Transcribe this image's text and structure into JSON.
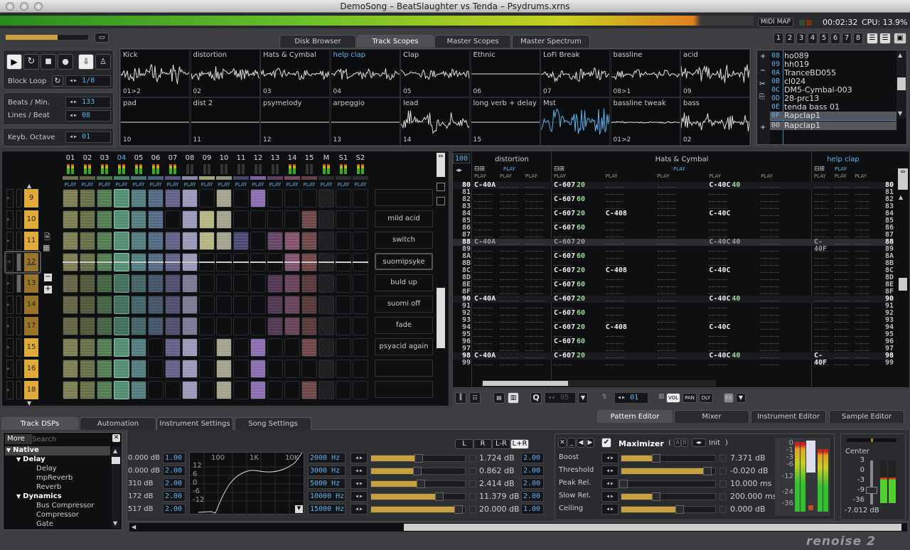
{
  "window": {
    "title": "DemoSong – BeatSlaughter vs Tenda – Psydrums.xrns"
  },
  "status": {
    "midi_map": "MIDI MAP",
    "time": "00:02:32",
    "cpu": "CPU: 13.9%"
  },
  "top_tabs": [
    "Disk Browser",
    "Track Scopes",
    "Master Scopes",
    "Master Spectrum"
  ],
  "top_tabs_active": 1,
  "layout_buttons": [
    "1",
    "2",
    "3",
    "4",
    "5",
    "6",
    "7",
    "8"
  ],
  "transport": {
    "block_loop_label": "Block Loop",
    "block_loop_value": "1/8",
    "bpm_label": "Beats / Min.",
    "bpm": "133",
    "lpb_label": "Lines / Beat",
    "lpb": "08",
    "octave_label": "Keyb. Octave",
    "octave": "01",
    "master_volume": 0.63
  },
  "scopes": [
    {
      "name": "Kick",
      "num": "01>2"
    },
    {
      "name": "distortion",
      "num": "02"
    },
    {
      "name": "Hats & Cymbal",
      "num": "03"
    },
    {
      "name": "help clap",
      "num": "04",
      "active": true
    },
    {
      "name": "Clap",
      "num": "05"
    },
    {
      "name": "Ethnic",
      "num": "06"
    },
    {
      "name": "LoFi Break",
      "num": "07"
    },
    {
      "name": "bassline",
      "num": "08>1"
    },
    {
      "name": "acid",
      "num": "09"
    },
    {
      "name": "pad",
      "num": "10"
    },
    {
      "name": "dist 2",
      "num": "11"
    },
    {
      "name": "psymelody",
      "num": "12"
    },
    {
      "name": "arpeggio",
      "num": "13"
    },
    {
      "name": "lead",
      "num": "14"
    },
    {
      "name": "long verb + delay",
      "num": "15"
    },
    {
      "name": "Mst",
      "num": "",
      "master": true
    },
    {
      "name": "bassline tweak",
      "num": "01>2"
    },
    {
      "name": "bass",
      "num": "02"
    }
  ],
  "instruments": [
    {
      "id": "08",
      "name": "ho089"
    },
    {
      "id": "09",
      "name": "hh019"
    },
    {
      "id": "0A",
      "name": "TranceBD055"
    },
    {
      "id": "0B",
      "name": "cl024"
    },
    {
      "id": "0C",
      "name": "DM5-Cymbal-003"
    },
    {
      "id": "0D",
      "name": "28-prc13"
    },
    {
      "id": "0E",
      "name": "tenda bass 01"
    },
    {
      "id": "0F",
      "name": "Rapclap1",
      "selected": true
    }
  ],
  "samples": [
    {
      "id": "00",
      "name": "Rapclap1",
      "selected": true
    }
  ],
  "matrix": {
    "tracks": [
      "01",
      "02",
      "03",
      "04",
      "05",
      "06",
      "07",
      "08",
      "09",
      "10",
      "11",
      "12",
      "13",
      "14",
      "15",
      "M",
      "S1",
      "S2"
    ],
    "play_label": "PLAY",
    "track_colors": [
      "#8a8a5c",
      "#6e7a4c",
      "#5a8a5a",
      "#5a9a7c",
      "#5a8a8c",
      "#5a7490",
      "#6a6a96",
      "#a8a8cc",
      "#c8c890",
      "#b4b49c",
      "#505080",
      "#9a78c4",
      "#704a70",
      "#905a78",
      "#7a4c4c",
      "#333333",
      "#333333",
      "#333333"
    ],
    "active_track": "04",
    "sequence": [
      {
        "pattern": "9",
        "name": "",
        "cells": "111111110101000h00"
      },
      {
        "pattern": "10",
        "name": "mild acid",
        "cells": "111111011100001h00"
      },
      {
        "pattern": "11",
        "name": "switch",
        "cells": "111111111110111h00"
      },
      {
        "pattern": "12",
        "name": "suomipsyke",
        "cells": "111111110000011h00",
        "current": true
      },
      {
        "pattern": "13",
        "name": "buld up",
        "cells": "111111110000111h00",
        "dim": true
      },
      {
        "pattern": "14",
        "name": "suomi off",
        "cells": "111111110000111h00",
        "dim": true
      },
      {
        "pattern": "17",
        "name": "fade",
        "cells": "111111110000111h00",
        "dim": true
      },
      {
        "pattern": "15",
        "name": "psyacid again",
        "cells": "111110110101001h00"
      },
      {
        "pattern": "16",
        "name": "",
        "cells": "111110110101000h00"
      },
      {
        "pattern": "18",
        "name": "",
        "cells": "111110010101001h00"
      }
    ]
  },
  "pattern": {
    "zoom": "100",
    "tracks": [
      {
        "name": "distortion",
        "cols": 3
      },
      {
        "name": "Hats & Cymbal",
        "cols": 5
      },
      {
        "name": "help clap",
        "cols": 3,
        "active": true
      }
    ],
    "play_label": "PLAY",
    "lines": [
      "80",
      "81",
      "82",
      "83",
      "84",
      "85",
      "86",
      "87",
      "88",
      "89",
      "8A",
      "8B",
      "8C",
      "8D",
      "8E",
      "8F",
      "90",
      "91",
      "92",
      "93",
      "94",
      "95",
      "96",
      "97",
      "98",
      "99"
    ],
    "cursor_line": "88",
    "notes": [
      {
        "line": "80",
        "t": 0,
        "c": 0,
        "note": "C-40A"
      },
      {
        "line": "88",
        "t": 0,
        "c": 0,
        "note": "C-40A"
      },
      {
        "line": "90",
        "t": 0,
        "c": 0,
        "note": "C-40A"
      },
      {
        "line": "98",
        "t": 0,
        "c": 0,
        "note": "C-40A"
      },
      {
        "line": "80",
        "t": 1,
        "c": 0,
        "note": "C-607",
        "vol": "20"
      },
      {
        "line": "82",
        "t": 1,
        "c": 0,
        "note": "C-607",
        "vol": "60"
      },
      {
        "line": "84",
        "t": 1,
        "c": 0,
        "note": "C-607",
        "vol": "20"
      },
      {
        "line": "86",
        "t": 1,
        "c": 0,
        "note": "C-607",
        "vol": "60"
      },
      {
        "line": "88",
        "t": 1,
        "c": 0,
        "note": "C-607",
        "vol": "20"
      },
      {
        "line": "8A",
        "t": 1,
        "c": 0,
        "note": "C-607",
        "vol": "60"
      },
      {
        "line": "8C",
        "t": 1,
        "c": 0,
        "note": "C-607",
        "vol": "20"
      },
      {
        "line": "8E",
        "t": 1,
        "c": 0,
        "note": "C-607",
        "vol": "60"
      },
      {
        "line": "90",
        "t": 1,
        "c": 0,
        "note": "C-607",
        "vol": "20"
      },
      {
        "line": "92",
        "t": 1,
        "c": 0,
        "note": "C-607",
        "vol": "60"
      },
      {
        "line": "94",
        "t": 1,
        "c": 0,
        "note": "C-607",
        "vol": "20"
      },
      {
        "line": "96",
        "t": 1,
        "c": 0,
        "note": "C-607",
        "vol": "60"
      },
      {
        "line": "98",
        "t": 1,
        "c": 0,
        "note": "C-607",
        "vol": "20"
      },
      {
        "line": "84",
        "t": 1,
        "c": 1,
        "note": "C-408"
      },
      {
        "line": "8C",
        "t": 1,
        "c": 1,
        "note": "C-408"
      },
      {
        "line": "94",
        "t": 1,
        "c": 1,
        "note": "C-408"
      },
      {
        "line": "80",
        "t": 1,
        "c": 3,
        "note": "C-40C",
        "vol": "40"
      },
      {
        "line": "84",
        "t": 1,
        "c": 3,
        "note": "C-40C"
      },
      {
        "line": "88",
        "t": 1,
        "c": 3,
        "note": "C-40C",
        "vol": "40"
      },
      {
        "line": "8C",
        "t": 1,
        "c": 3,
        "note": "C-40C"
      },
      {
        "line": "90",
        "t": 1,
        "c": 3,
        "note": "C-40C",
        "vol": "40"
      },
      {
        "line": "94",
        "t": 1,
        "c": 3,
        "note": "C-40C"
      },
      {
        "line": "98",
        "t": 1,
        "c": 3,
        "note": "C-40C",
        "vol": "40"
      },
      {
        "line": "88",
        "t": 2,
        "c": 0,
        "note": "C-40F"
      },
      {
        "line": "98",
        "t": 2,
        "c": 0,
        "note": "C-40F"
      }
    ]
  },
  "pattern_toolbar": {
    "quantize": "Q",
    "quantize_value": "05",
    "edit_step": "01",
    "vol": "VOL",
    "pan": "PAN",
    "dly": "DLY",
    "fx": "FX"
  },
  "lower_tabs_right": [
    "Pattern Editor",
    "Mixer",
    "Instrument Editor",
    "Sample Editor"
  ],
  "lower_tabs_left": [
    "Track DSPs",
    "Automation",
    "Instrument Settings",
    "Song Settings"
  ],
  "dsp_browser": {
    "more": "More",
    "search_placeholder": "Search",
    "tree": [
      {
        "label": "Native",
        "level": 0,
        "folder": true
      },
      {
        "label": "Delay",
        "level": 1,
        "folder": true
      },
      {
        "label": "Delay",
        "level": 2
      },
      {
        "label": "mpReverb",
        "level": 2
      },
      {
        "label": "Reverb",
        "level": 2
      },
      {
        "label": "Dynamics",
        "level": 1,
        "folder": true
      },
      {
        "label": "Bus Compressor",
        "level": 2
      },
      {
        "label": "Compressor",
        "level": 2
      },
      {
        "label": "Gate",
        "level": 2
      }
    ]
  },
  "eq": {
    "left_gains": [
      "0.000 dB",
      "0.000 dB",
      "310 dB",
      "172 dB",
      "517 dB"
    ],
    "left_q": [
      "1.00",
      "2.00",
      "2.00",
      "2.00",
      "2.00"
    ],
    "graph_x_labels": [
      "100",
      "1K",
      "10K"
    ],
    "graph_y_labels": [
      "12",
      "6",
      "0",
      "-6",
      "-12"
    ],
    "channels": [
      "L",
      "R",
      "L-R",
      "L+R"
    ],
    "channel_active": "L+R",
    "bands": [
      {
        "freq": "2000 Hz",
        "gain": "1.724 dB",
        "level": 0.54,
        "q": "2.00"
      },
      {
        "freq": "3000 Hz",
        "gain": "0.862 dB",
        "level": 0.52,
        "q": "2.00"
      },
      {
        "freq": "5000 Hz",
        "gain": "2.414 dB",
        "level": 0.56,
        "q": "2.00"
      },
      {
        "freq": "10000 Hz",
        "gain": "11.379 dB",
        "level": 0.76,
        "q": "2.00"
      },
      {
        "freq": "15000 Hz",
        "gain": "20.000 dB",
        "level": 0.96,
        "q": "1.00"
      }
    ]
  },
  "maximizer": {
    "title": "Maximizer",
    "preset": "Init",
    "ab": [
      "A",
      "B"
    ],
    "params": [
      {
        "label": "Boost",
        "value": "7.371 dB",
        "level": 0.4
      },
      {
        "label": "Threshold",
        "value": "-0.020 dB",
        "level": 0.95
      },
      {
        "label": "Peak Rel.",
        "value": "10.000 ms",
        "level": 0.05
      },
      {
        "label": "Slow Rel.",
        "value": "200.000 ms",
        "level": 0.4
      },
      {
        "label": "Ceiling",
        "value": "0.000 dB",
        "level": 0.65
      }
    ],
    "meter_labels": [
      "0",
      "-1",
      "-3",
      "-6",
      "-12",
      "-24",
      "-36"
    ]
  },
  "master_gain": {
    "pan_label": "Center",
    "scale": [
      "3",
      "0",
      "-3",
      "-9",
      "-36"
    ],
    "value": "-7.012 dB",
    "level": 0.32
  },
  "footer": {
    "logo": "renoise 2"
  }
}
